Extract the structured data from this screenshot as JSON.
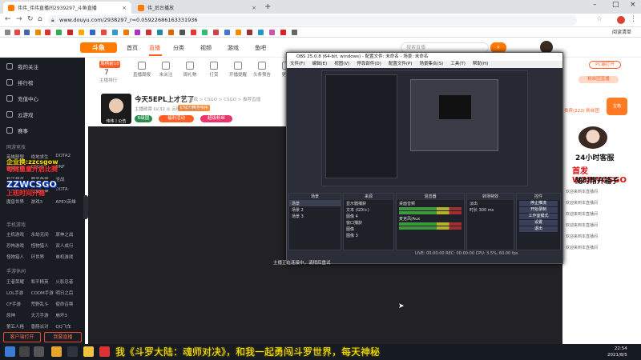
{
  "browser": {
    "tabs": [
      {
        "label": "伟伟_伟伟直播间2939297_斗鱼直播",
        "icon": "douyu-favicon"
      },
      {
        "label": "伟_后台播放",
        "icon": "douyu-favicon"
      }
    ],
    "new_tab_label": "+",
    "url": "www.douyu.com/2938297_r=0.05922686163331936",
    "reading_list": "阅读清单",
    "colors": {
      "accent": "#ff5d23",
      "tabbar": "#dfe1e5"
    }
  },
  "site": {
    "logo_text": "斗鱼",
    "nav": [
      "首页",
      "直播",
      "分类",
      "视频",
      "游戏",
      "鱼吧"
    ],
    "search_placeholder": "搜索直播",
    "search_btn": "⌕"
  },
  "sidebar": {
    "items": [
      {
        "label": "我的关注",
        "icon": "heart-icon"
      },
      {
        "label": "排行榜",
        "icon": "rank-icon"
      },
      {
        "label": "充值中心",
        "icon": "wallet-icon"
      },
      {
        "label": "云游戏",
        "icon": "cloud-icon"
      },
      {
        "label": "赛事",
        "icon": "trophy-icon"
      }
    ],
    "section1": "网游竞技",
    "section2": "手机游戏",
    "section3": "手游休闲",
    "games1": [
      "英雄联盟",
      "绝地求生",
      "DOTA2",
      "穿越火线",
      "CSGO",
      "DNF",
      "和平精英",
      "魔兽争霸",
      "逆战",
      "VALORANT",
      "守望先锋",
      "DOTA",
      "魔兽世界",
      "游戏3",
      "APEX英雄"
    ],
    "games2": [
      "主机游戏",
      "永劫无间",
      "原神之战",
      "恐怖游戏",
      "怪物猎人",
      "双人成行",
      "怪物猎人",
      "环世界",
      "单机游戏"
    ],
    "games3": [
      "王者荣耀",
      "和平精英",
      "火影忍者",
      "LOL手游",
      "CODM手游",
      "明日之后",
      "CF手游",
      "荒野乱斗",
      "使命召唤",
      "原神",
      "天刀手游",
      "崩坏3",
      "第五人格",
      "香肠派对",
      "QQ飞车"
    ],
    "footer_left": "客户端打开",
    "footer_right": "我要直播"
  },
  "overlay_left": {
    "line1": "企业换:zzcsgow",
    "line2": "每周重量开启比赛",
    "line3": "ZZWCSGO",
    "line4": "上班时间开箱"
  },
  "room": {
    "rank_badge": "周榜前10",
    "rank_number": "7",
    "rank_label": "主播排行",
    "tools": [
      "直播周报",
      "未关注",
      "周礼物",
      "打赏",
      "开播提醒",
      "头条预告",
      "更多"
    ],
    "title": "今天5EPL上才艺了",
    "meta": "游戏 > CSGO > CSGO > 推荐直播",
    "badge": "CSGO精选伟伟",
    "meta2": "主播勋章  LV.32  ◎ 云投 ⊕ 99+kg",
    "avatar_tag": "伟伟丨公告",
    "pills": [
      "6级国",
      "福利活动",
      "超级粉丝"
    ],
    "pill_colors": [
      "#2a8c4a",
      "#ff5d23",
      "#e8366a"
    ]
  },
  "obs": {
    "title": "OBS 25.0.8 (64-bit, windows) - 配置文件: 未命名 - 场景: 未命名",
    "menu": [
      "文件(F)",
      "编辑(E)",
      "视图(V)",
      "停靠部件(D)",
      "配置文件(P)",
      "场景集合(S)",
      "工具(T)",
      "帮助(H)"
    ],
    "docks": {
      "scenes_title": "场景",
      "scenes": [
        "场景",
        "场景 2",
        "场景 3"
      ],
      "sources_title": "来源",
      "sources": [
        "显示器捕获",
        "文本 (GDI+)",
        "图像 4",
        "窗口捕获",
        "图像",
        "图像 3"
      ],
      "mixer_title": "混音器",
      "mixer": [
        "桌面音频",
        "麦克风/Aux"
      ],
      "trans_title": "转场特效",
      "trans_items": [
        "淡出",
        "时长 300 ms"
      ],
      "controls_title": "控件",
      "controls": [
        "停止推流",
        "开始录制",
        "工作室模式",
        "设置",
        "退出"
      ]
    },
    "status": "LIVE: 00:00:00  REC: 00:00:00  CPU: 3.5%, 60.00 fps",
    "caption": "主播正在连接中，请稍后重试"
  },
  "right_panel": {
    "pc_open": "PC端打开",
    "fans": "粉丝团直播",
    "chest": "宝箱",
    "tabs": "贵宾(222)  粉丝团",
    "chat": [
      "欢迎来到本直播间",
      "欢迎来到本直播间",
      "欢迎来到本直播间",
      "欢迎来到本直播间",
      "欢迎来到本直播间",
      "欢迎来到本直播间"
    ],
    "ad1": "24小时客服",
    "ad2": "首发 WZZWCSGO",
    "ad3": "随时帮开箱子"
  },
  "subtitle": "我《斗罗大陆：魂师对决》，和我一起勇闯斗罗世界，每天神秘",
  "taskbar": {
    "time": "22:54",
    "date": "2021/8/5"
  }
}
